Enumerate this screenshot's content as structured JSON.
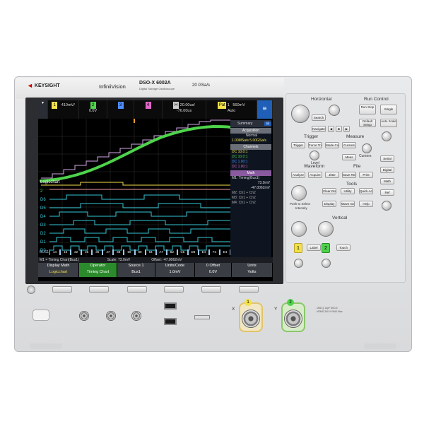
{
  "brand": {
    "logo": "KEYSIGHT",
    "series": "InfiniiVision",
    "model": "DSO-X 6002A",
    "model_sub": "Digital Storage Oscilloscope",
    "rate": "20 GSa/s"
  },
  "channels": [
    {
      "num": "1",
      "v1": "410mV/",
      "v2": "",
      "color": "#f3e14a"
    },
    {
      "num": "2",
      "v1": "",
      "v2": "0.0V",
      "color": "#4ed34b"
    },
    {
      "num": "3",
      "v1": "",
      "v2": "",
      "color": "#4e8dff"
    },
    {
      "num": "4",
      "v1": "",
      "v2": "",
      "color": "#e066c8"
    }
  ],
  "timebase": {
    "label": "H",
    "v1": "20.00us/",
    "v2": "-76.00us"
  },
  "trigger": {
    "mode": "Pat",
    "ch": "1",
    "v1": "560mV",
    "v2": "Auto"
  },
  "summary": {
    "title": "Summary",
    "acq_head": "Acquisition",
    "acq_mode": "Normal",
    "acq_rate": "1.00MSa/s  5.00GSa/s",
    "chan_head": "Channels",
    "chan_lines": [
      "DC    10.0:1",
      "DC    10.0:1",
      "DC     1.00:1",
      "DC     1.00:1"
    ],
    "math_head": "Math",
    "math_lines": [
      "M1:  Timing(Bus1)",
      "73.0mV",
      "-47.0062mV",
      "M2:    Ch1 + Ch2",
      "M3:    Ch1 + Ch2",
      "M4:    Ch1 + Ch2"
    ]
  },
  "trace_labels": [
    "Logicchart",
    "2",
    "D6",
    "D5",
    "D4",
    "D3",
    "D2",
    "D1",
    "D0",
    "BUS1"
  ],
  "bus_values": [
    "14",
    "15",
    "22",
    "25",
    "36",
    "47",
    "58",
    "69",
    "80",
    "94",
    "A7",
    "B2",
    "C5",
    "D8",
    "E4",
    "F4",
    "E4"
  ],
  "status_bar": {
    "left": "M1 = Timing Chart(Bus1)",
    "scale": "Scale: 73.0mV",
    "offset": "Offset: -47.0062mV"
  },
  "softkeys": [
    {
      "top": "Display Math",
      "bottom": "Logicchart"
    },
    {
      "top": "Operator",
      "bottom": "Timing Chart"
    },
    {
      "top": "Source 1",
      "bottom": "Bus1"
    },
    {
      "top": "Units/Code",
      "bottom": "1.0mV"
    },
    {
      "top": "0 Offset",
      "bottom": "0.0V"
    },
    {
      "top": "Units",
      "bottom": "Volts"
    }
  ],
  "panel": {
    "horizontal": "Horizontal",
    "run_control": "Run Control",
    "run_stop": "Run Stop",
    "single": "Single",
    "search": "Search",
    "navigate": "Navigate",
    "default_setup": "Default Setup",
    "auto_scale": "Auto Scale",
    "trigger": "Trigger",
    "measure": "Measure",
    "trig_btns": [
      "Trigger",
      "Force Trigger",
      "Mode Coupling",
      "Cursors",
      "Meas"
    ],
    "level": "Level",
    "cursors": "Cursors",
    "waveform": "Waveform",
    "file": "File",
    "wave_btns": [
      "Analyze",
      "Acquire",
      "Jitter",
      "Save Recall",
      "Print"
    ],
    "tools": "Tools",
    "tool_btns": [
      "Clear Display",
      "Utility",
      "Quick Action",
      "Display",
      "Wave Gen",
      "Help"
    ],
    "push_select": "Push to Select",
    "intensity": "Intensity",
    "side_btns": [
      "Serial",
      "Digital",
      "Math",
      "Ref"
    ],
    "vertical": "Vertical",
    "label": "Label",
    "touch": "Touch",
    "ch_nums": [
      "1",
      "2"
    ],
    "input_x": "X",
    "input_y": "Y",
    "spec": "1MΩ || 14pF  50Ω 5 VRMS  300 V RMS Max"
  },
  "colors": {
    "ch1": "#f3e14a",
    "ch2": "#4ed34b",
    "digital": "#35c6d6",
    "bus": "#9fc7e6",
    "math": "#d6a8e8"
  }
}
